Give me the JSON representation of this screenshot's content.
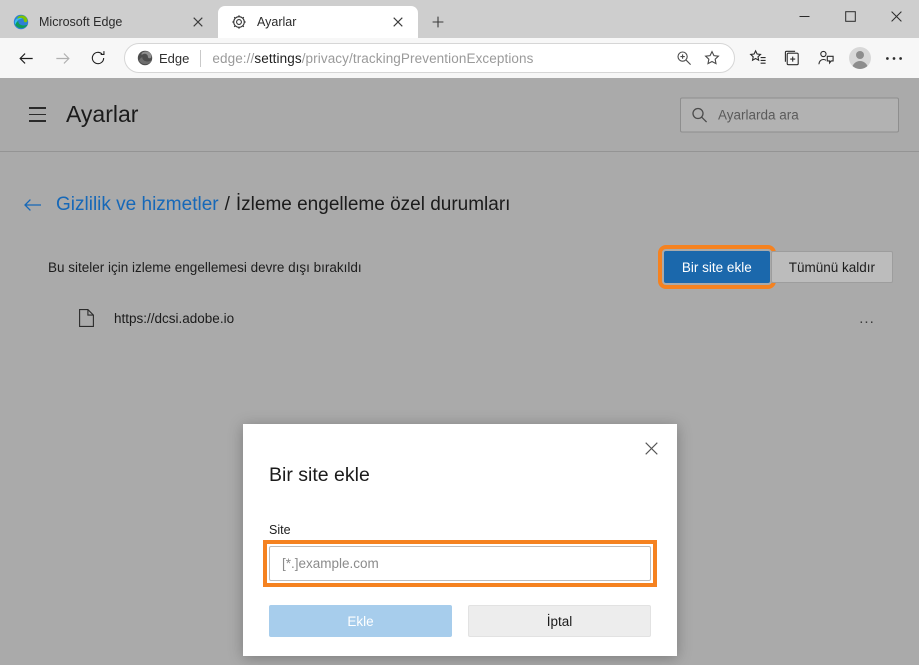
{
  "window": {
    "controls": {
      "minimize_label": "Simge durumuna küçült",
      "maximize_label": "Ekranı kapla",
      "close_label": "Kapat"
    }
  },
  "tabs": [
    {
      "title": "Microsoft Edge",
      "favicon": "edge-logo-icon",
      "active": false
    },
    {
      "title": "Ayarlar",
      "favicon": "gear-icon",
      "active": true
    }
  ],
  "newtab": {
    "label": "+"
  },
  "toolbar": {
    "back_label": "Geri",
    "forward_label": "İleri",
    "refresh_label": "Yenile",
    "omnibox": {
      "brand": "Edge",
      "url_prefix": "edge://",
      "url_bold": "settings",
      "url_suffix": "/privacy/trackingPreventionExceptions",
      "url_full": "edge://settings/privacy/trackingPreventionExceptions",
      "zoom_icon": "zoom-icon",
      "favorite_icon": "star-icon"
    },
    "icons": [
      {
        "name": "favorites-icon",
        "label": "Sık kullanılanlar"
      },
      {
        "name": "collections-icon",
        "label": "Koleksiyonlar"
      },
      {
        "name": "share-icon",
        "label": "Paylaş"
      },
      {
        "name": "profile-avatar",
        "label": "Profil"
      },
      {
        "name": "more-icon",
        "label": "Ayarlar ve daha fazlası"
      }
    ]
  },
  "settings": {
    "menu_icon": "hamburger-icon",
    "title": "Ayarlar",
    "search": {
      "placeholder": "Ayarlarda ara",
      "value": "",
      "icon": "search-icon"
    },
    "breadcrumb": {
      "back_icon": "arrow-left-icon",
      "parent": "Gizlilik ve hizmetler",
      "separator": "/",
      "current": "İzleme engelleme özel durumları"
    },
    "section": {
      "label": "Bu siteler için izleme engellemesi devre dışı bırakıldı",
      "add_button": "Bir site ekle",
      "remove_all_button": "Tümünü kaldır"
    },
    "sites": [
      {
        "icon": "document-icon",
        "name": "https://dcsi.adobe.io",
        "more": "..."
      }
    ]
  },
  "dialog": {
    "title": "Bir site ekle",
    "close_icon": "close-icon",
    "field_label": "Site",
    "input_placeholder": "[*.]example.com",
    "input_value": "",
    "add_button": "Ekle",
    "cancel_button": "İptal"
  },
  "colors": {
    "accent_blue": "#1b68ac",
    "link_blue": "#1668b8",
    "highlight_orange": "#f58220",
    "disabled_blue": "#a7cdec",
    "page_dim": "#aaaaaa"
  }
}
